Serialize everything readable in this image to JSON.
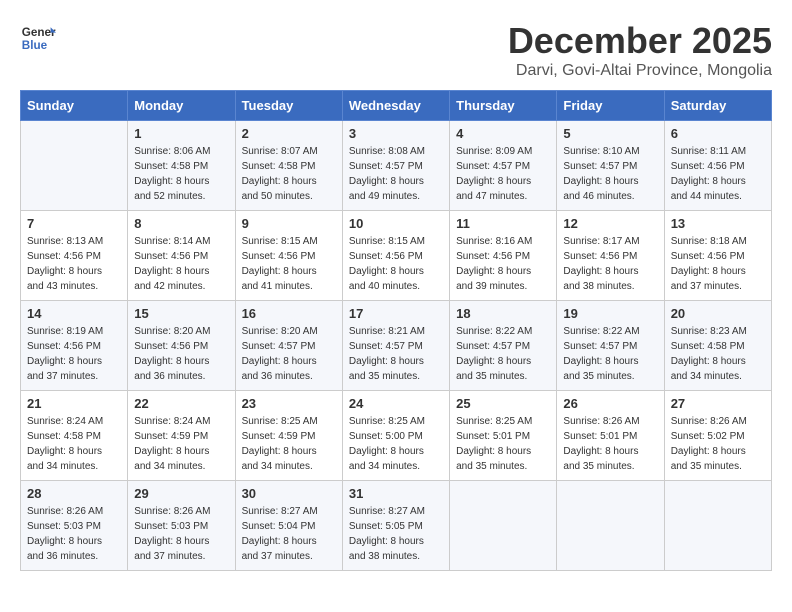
{
  "header": {
    "logo_line1": "General",
    "logo_line2": "Blue",
    "month": "December 2025",
    "location": "Darvi, Govi-Altai Province, Mongolia"
  },
  "weekdays": [
    "Sunday",
    "Monday",
    "Tuesday",
    "Wednesday",
    "Thursday",
    "Friday",
    "Saturday"
  ],
  "weeks": [
    [
      {
        "day": "",
        "info": ""
      },
      {
        "day": "1",
        "info": "Sunrise: 8:06 AM\nSunset: 4:58 PM\nDaylight: 8 hours\nand 52 minutes."
      },
      {
        "day": "2",
        "info": "Sunrise: 8:07 AM\nSunset: 4:58 PM\nDaylight: 8 hours\nand 50 minutes."
      },
      {
        "day": "3",
        "info": "Sunrise: 8:08 AM\nSunset: 4:57 PM\nDaylight: 8 hours\nand 49 minutes."
      },
      {
        "day": "4",
        "info": "Sunrise: 8:09 AM\nSunset: 4:57 PM\nDaylight: 8 hours\nand 47 minutes."
      },
      {
        "day": "5",
        "info": "Sunrise: 8:10 AM\nSunset: 4:57 PM\nDaylight: 8 hours\nand 46 minutes."
      },
      {
        "day": "6",
        "info": "Sunrise: 8:11 AM\nSunset: 4:56 PM\nDaylight: 8 hours\nand 44 minutes."
      }
    ],
    [
      {
        "day": "7",
        "info": "Sunrise: 8:13 AM\nSunset: 4:56 PM\nDaylight: 8 hours\nand 43 minutes."
      },
      {
        "day": "8",
        "info": "Sunrise: 8:14 AM\nSunset: 4:56 PM\nDaylight: 8 hours\nand 42 minutes."
      },
      {
        "day": "9",
        "info": "Sunrise: 8:15 AM\nSunset: 4:56 PM\nDaylight: 8 hours\nand 41 minutes."
      },
      {
        "day": "10",
        "info": "Sunrise: 8:15 AM\nSunset: 4:56 PM\nDaylight: 8 hours\nand 40 minutes."
      },
      {
        "day": "11",
        "info": "Sunrise: 8:16 AM\nSunset: 4:56 PM\nDaylight: 8 hours\nand 39 minutes."
      },
      {
        "day": "12",
        "info": "Sunrise: 8:17 AM\nSunset: 4:56 PM\nDaylight: 8 hours\nand 38 minutes."
      },
      {
        "day": "13",
        "info": "Sunrise: 8:18 AM\nSunset: 4:56 PM\nDaylight: 8 hours\nand 37 minutes."
      }
    ],
    [
      {
        "day": "14",
        "info": "Sunrise: 8:19 AM\nSunset: 4:56 PM\nDaylight: 8 hours\nand 37 minutes."
      },
      {
        "day": "15",
        "info": "Sunrise: 8:20 AM\nSunset: 4:56 PM\nDaylight: 8 hours\nand 36 minutes."
      },
      {
        "day": "16",
        "info": "Sunrise: 8:20 AM\nSunset: 4:57 PM\nDaylight: 8 hours\nand 36 minutes."
      },
      {
        "day": "17",
        "info": "Sunrise: 8:21 AM\nSunset: 4:57 PM\nDaylight: 8 hours\nand 35 minutes."
      },
      {
        "day": "18",
        "info": "Sunrise: 8:22 AM\nSunset: 4:57 PM\nDaylight: 8 hours\nand 35 minutes."
      },
      {
        "day": "19",
        "info": "Sunrise: 8:22 AM\nSunset: 4:57 PM\nDaylight: 8 hours\nand 35 minutes."
      },
      {
        "day": "20",
        "info": "Sunrise: 8:23 AM\nSunset: 4:58 PM\nDaylight: 8 hours\nand 34 minutes."
      }
    ],
    [
      {
        "day": "21",
        "info": "Sunrise: 8:24 AM\nSunset: 4:58 PM\nDaylight: 8 hours\nand 34 minutes."
      },
      {
        "day": "22",
        "info": "Sunrise: 8:24 AM\nSunset: 4:59 PM\nDaylight: 8 hours\nand 34 minutes."
      },
      {
        "day": "23",
        "info": "Sunrise: 8:25 AM\nSunset: 4:59 PM\nDaylight: 8 hours\nand 34 minutes."
      },
      {
        "day": "24",
        "info": "Sunrise: 8:25 AM\nSunset: 5:00 PM\nDaylight: 8 hours\nand 34 minutes."
      },
      {
        "day": "25",
        "info": "Sunrise: 8:25 AM\nSunset: 5:01 PM\nDaylight: 8 hours\nand 35 minutes."
      },
      {
        "day": "26",
        "info": "Sunrise: 8:26 AM\nSunset: 5:01 PM\nDaylight: 8 hours\nand 35 minutes."
      },
      {
        "day": "27",
        "info": "Sunrise: 8:26 AM\nSunset: 5:02 PM\nDaylight: 8 hours\nand 35 minutes."
      }
    ],
    [
      {
        "day": "28",
        "info": "Sunrise: 8:26 AM\nSunset: 5:03 PM\nDaylight: 8 hours\nand 36 minutes."
      },
      {
        "day": "29",
        "info": "Sunrise: 8:26 AM\nSunset: 5:03 PM\nDaylight: 8 hours\nand 37 minutes."
      },
      {
        "day": "30",
        "info": "Sunrise: 8:27 AM\nSunset: 5:04 PM\nDaylight: 8 hours\nand 37 minutes."
      },
      {
        "day": "31",
        "info": "Sunrise: 8:27 AM\nSunset: 5:05 PM\nDaylight: 8 hours\nand 38 minutes."
      },
      {
        "day": "",
        "info": ""
      },
      {
        "day": "",
        "info": ""
      },
      {
        "day": "",
        "info": ""
      }
    ]
  ]
}
